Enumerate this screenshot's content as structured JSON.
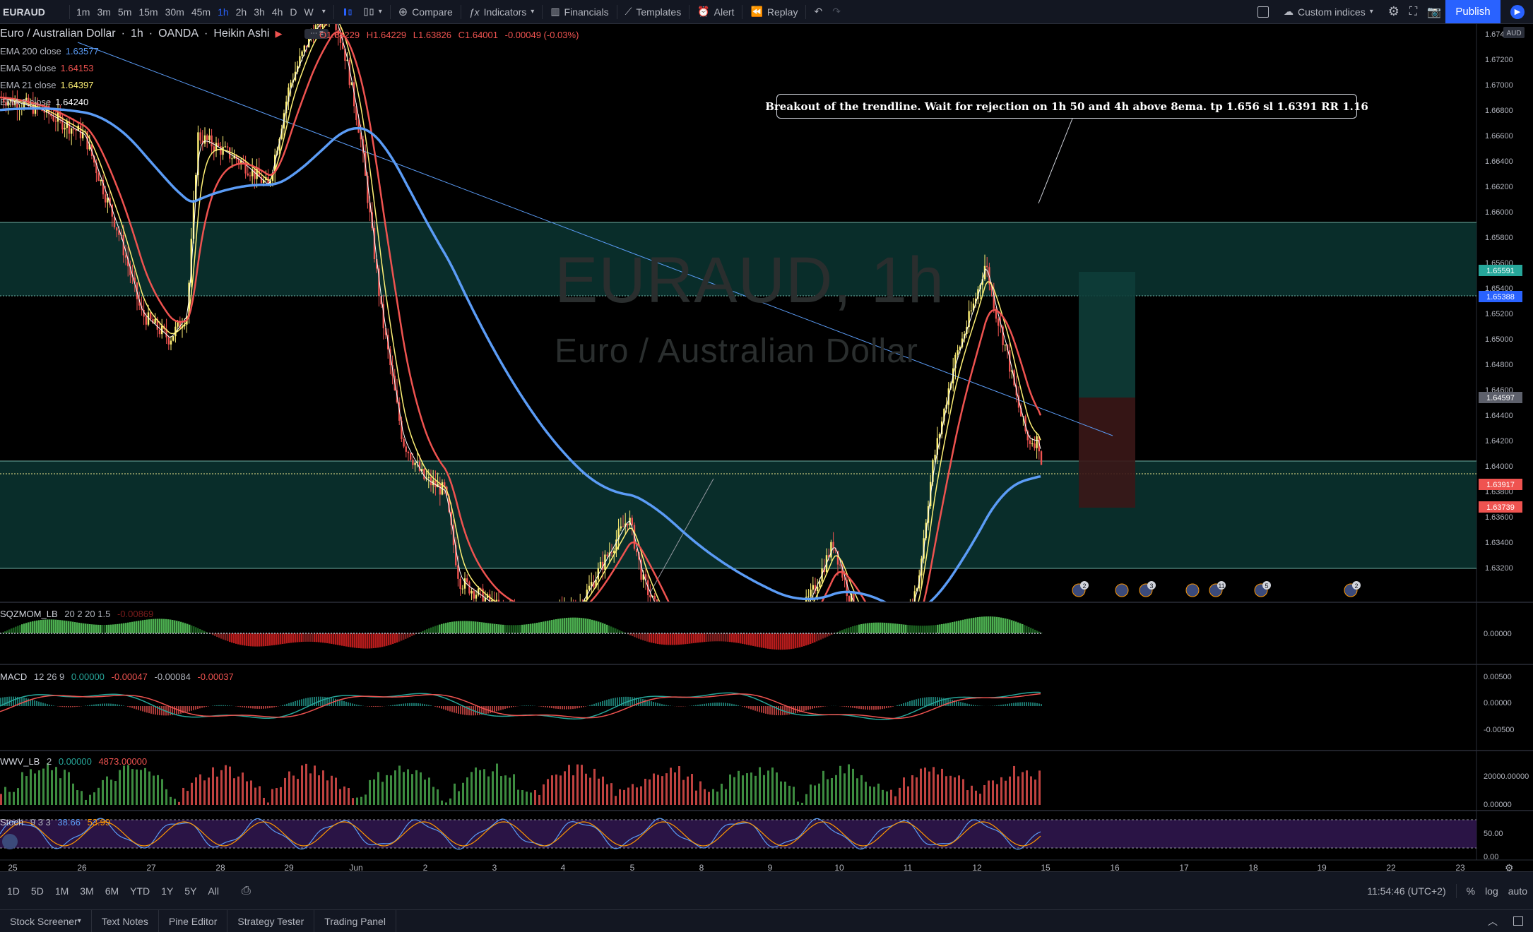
{
  "toolbar": {
    "symbol": "EURAUD",
    "intervals": [
      "1m",
      "3m",
      "5m",
      "15m",
      "30m",
      "45m",
      "1h",
      "2h",
      "3h",
      "4h",
      "D",
      "W"
    ],
    "active_interval": "1h",
    "compare": "Compare",
    "indicators": "Indicators",
    "financials": "Financials",
    "templates": "Templates",
    "alert": "Alert",
    "replay": "Replay",
    "custom_indices": "Custom indices",
    "publish": "Publish"
  },
  "header": {
    "instrument": "Euro / Australian Dollar",
    "interval": "1h",
    "exchange": "OANDA",
    "chart_style": "Heikin Ashi",
    "ohlc": {
      "o": "O1.64229",
      "h": "H1.64229",
      "l": "L1.63826",
      "c": "C1.64001",
      "chg": "-0.00049 (-0.03%)"
    }
  },
  "ema_legend": [
    {
      "label": "EMA 200 close",
      "value": "1.63577",
      "color": "#5b9cf6"
    },
    {
      "label": "EMA 50 close",
      "value": "1.64153",
      "color": "#ef5350"
    },
    {
      "label": "EMA 21 close",
      "value": "1.64397",
      "color": "#fff176"
    },
    {
      "label": "EMA 8 close",
      "value": "1.64240",
      "color": "#ffffff"
    }
  ],
  "watermark": {
    "title": "EURAUD, 1h",
    "subtitle": "Euro / Australian Dollar"
  },
  "annotation": "Breakout of the trendline. Wait for rejection on 1h 50 and 4h above 8ema. tp 1.656 sl 1.6391 RR 1.16",
  "price_axis": {
    "currency": "AUD",
    "labels": [
      "1.67400",
      "1.67200",
      "1.67000",
      "1.66800",
      "1.66600",
      "1.66400",
      "1.66200",
      "1.66000",
      "1.65800",
      "1.65600",
      "1.65400",
      "1.65200",
      "1.65000",
      "1.64800",
      "1.64600",
      "1.64400",
      "1.64200",
      "1.64000",
      "1.63800",
      "1.63600",
      "1.63400",
      "1.63200"
    ],
    "tags": [
      {
        "text": "1.65591",
        "color": "#26a69a"
      },
      {
        "text": "1.65388",
        "color": "#2962ff"
      },
      {
        "text": "1.64597",
        "color": "#5d606b"
      },
      {
        "text": "1.63917",
        "color": "#ef5350"
      },
      {
        "text": "1.63739",
        "color": "#ef5350"
      }
    ]
  },
  "event_markers": [
    "2",
    "",
    "3",
    "",
    "11",
    "5",
    "2"
  ],
  "panes": {
    "sqzmom": {
      "label": "SQZMOM_LB",
      "params": "20 2 20 1.5",
      "value": "-0.00869",
      "axis": [
        "0.00000"
      ]
    },
    "macd": {
      "label": "MACD",
      "params": "12 26 9",
      "v1": "0.00000",
      "v2": "-0.00047",
      "v3": "-0.00084",
      "v4": "-0.00037",
      "axis": [
        "0.00500",
        "0.00000",
        "-0.00500"
      ]
    },
    "wwv": {
      "label": "WWV_LB",
      "params": "2",
      "v1": "0.00000",
      "v2": "4873.00000",
      "axis": [
        "20000.00000",
        "0.00000"
      ]
    },
    "stoch": {
      "label": "Stoch",
      "params": "9 3 3",
      "v1": "38.66",
      "v2": "53.99",
      "axis": [
        "50.00",
        "0.00"
      ]
    }
  },
  "time_axis": [
    "25",
    "26",
    "27",
    "28",
    "29",
    "Jun",
    "2",
    "3",
    "4",
    "5",
    "8",
    "9",
    "10",
    "11",
    "12",
    "15",
    "16",
    "17",
    "18",
    "19",
    "22",
    "23"
  ],
  "timebar": {
    "ranges": [
      "1D",
      "5D",
      "1M",
      "3M",
      "6M",
      "YTD",
      "1Y",
      "5Y",
      "All"
    ],
    "clock": "11:54:46 (UTC+2)",
    "percent": "%",
    "log": "log",
    "auto": "auto"
  },
  "bottom_tabs": [
    "Stock Screener",
    "Text Notes",
    "Pine Editor",
    "Strategy Tester",
    "Trading Panel"
  ]
}
